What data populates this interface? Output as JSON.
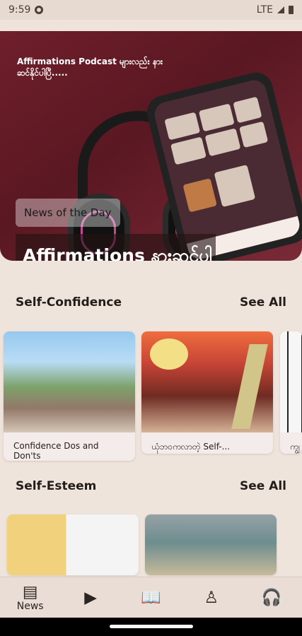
{
  "status": {
    "time": "9:59",
    "network": "LTE"
  },
  "hero": {
    "caption": "Affirmations Podcast များလည်း နားဆင်နိုင်ပါပြီ.....",
    "badge": "News of the Day",
    "headline": "Affirmations နားဆင်ပါ"
  },
  "sections": [
    {
      "title": "Self-Confidence",
      "see_all": "See All",
      "cards": [
        {
          "title": "Confidence Dos and Don'ts"
        },
        {
          "title": "ယုံဘဝကလာတဲ့ Self-..."
        },
        {
          "title": "ကျွ"
        }
      ]
    },
    {
      "title": "Self-Esteem",
      "see_all": "See All"
    }
  ],
  "nav": [
    {
      "label": "News",
      "icon": "news-icon"
    },
    {
      "label": "",
      "icon": "video-icon"
    },
    {
      "label": "",
      "icon": "book-icon"
    },
    {
      "label": "",
      "icon": "meditation-icon"
    },
    {
      "label": "",
      "icon": "headphones-icon"
    }
  ]
}
